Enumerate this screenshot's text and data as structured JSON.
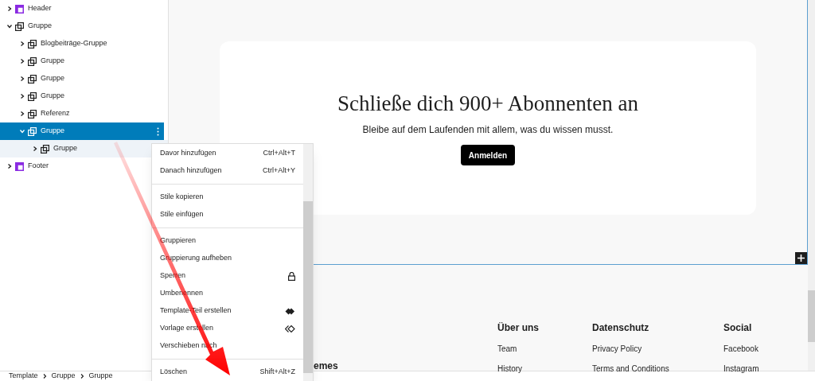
{
  "list_view": [
    {
      "label": "Header",
      "kind": "template-part",
      "expanded": false,
      "selected": false
    },
    {
      "label": "Gruppe",
      "kind": "group",
      "expanded": true,
      "selected": false,
      "children": [
        {
          "label": "Blogbeiträge-Gruppe",
          "kind": "group",
          "expanded": false,
          "selected": false
        },
        {
          "label": "Gruppe",
          "kind": "group",
          "expanded": false,
          "selected": false
        },
        {
          "label": "Gruppe",
          "kind": "group",
          "expanded": false,
          "selected": false
        },
        {
          "label": "Gruppe",
          "kind": "group",
          "expanded": false,
          "selected": false
        },
        {
          "label": "Referenz",
          "kind": "group",
          "expanded": false,
          "selected": false
        },
        {
          "label": "Gruppe",
          "kind": "group",
          "expanded": true,
          "selected": true,
          "children": [
            {
              "label": "Gruppe",
              "kind": "group",
              "expanded": false,
              "selected": false
            }
          ]
        }
      ]
    },
    {
      "label": "Footer",
      "kind": "template-part",
      "expanded": false,
      "selected": false
    }
  ],
  "context_menu": [
    [
      {
        "label": "Davor hinzufügen",
        "shortcut": "Ctrl+Alt+T"
      },
      {
        "label": "Danach hinzufügen",
        "shortcut": "Ctrl+Alt+Y"
      }
    ],
    [
      {
        "label": "Stile kopieren"
      },
      {
        "label": "Stile einfügen"
      }
    ],
    [
      {
        "label": "Gruppieren"
      },
      {
        "label": "Gruppierung aufheben"
      },
      {
        "label": "Sperren",
        "kind": "lock"
      },
      {
        "label": "Umbenennen"
      },
      {
        "label": "Template-Teil erstellen",
        "kind": "template-part"
      },
      {
        "label": "Vorlage erstellen",
        "kind": "pattern"
      },
      {
        "label": "Verschieben nach"
      }
    ],
    [
      {
        "label": "Löschen",
        "shortcut": "Shift+Alt+Z"
      }
    ]
  ],
  "canvas": {
    "heading": "Schließe dich 900+ Abonnenten an",
    "text": "Bleibe auf dem Laufenden mit allem, was du wissen musst.",
    "button": "Anmelden",
    "footer": {
      "fragment": "emes",
      "columns": [
        {
          "heading": "Über uns",
          "links": [
            "Team",
            "History"
          ]
        },
        {
          "heading": "Datenschutz",
          "links": [
            "Privacy Policy",
            "Terms and Conditions"
          ]
        },
        {
          "heading": "Social",
          "links": [
            "Facebook",
            "Instagram"
          ]
        }
      ]
    }
  },
  "breadcrumbs": [
    "Template",
    "Gruppe",
    "Gruppe"
  ]
}
